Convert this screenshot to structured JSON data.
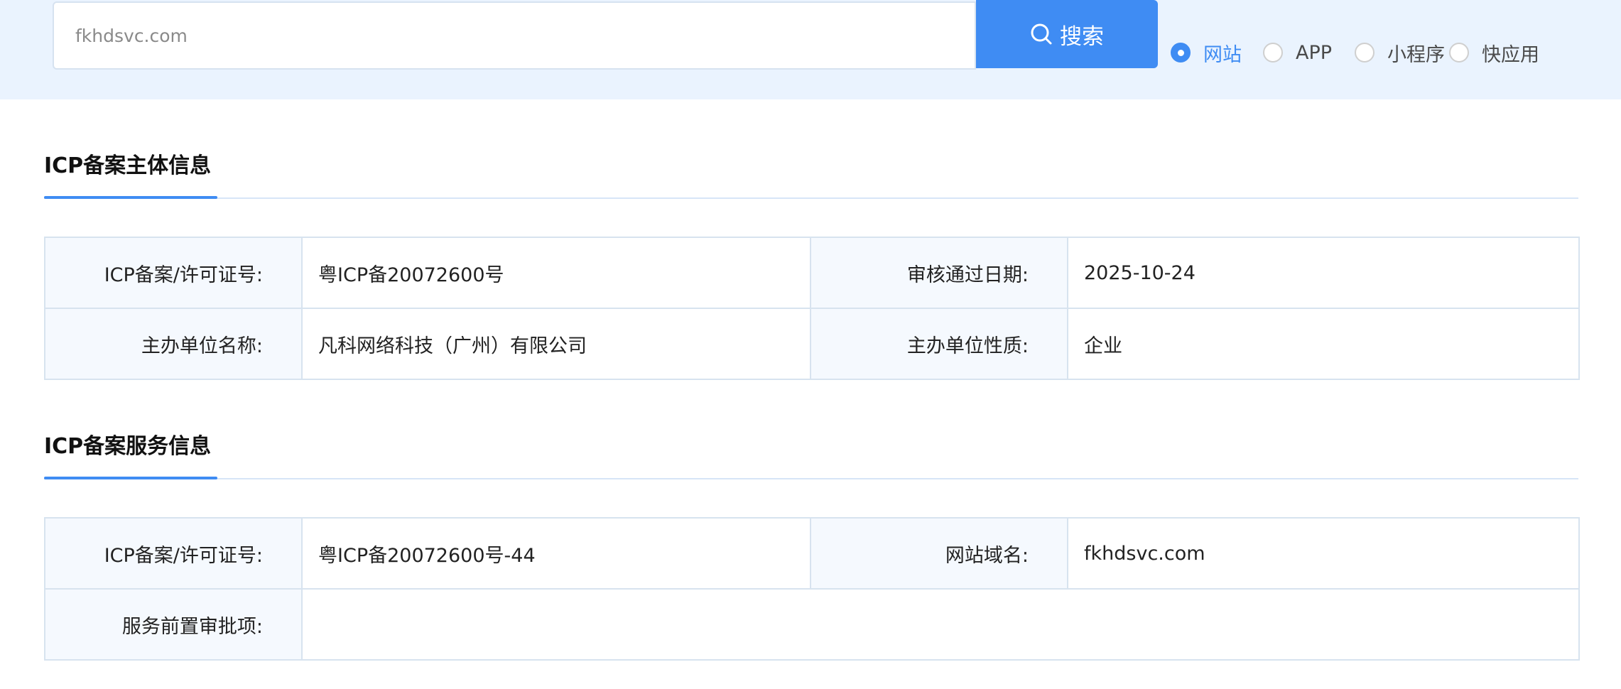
{
  "search": {
    "value": "fkhdsvc.com",
    "button_label": "搜索"
  },
  "radio_options": [
    {
      "label": "网站",
      "checked": true
    },
    {
      "label": "APP",
      "checked": false
    },
    {
      "label": "小程序",
      "checked": false
    },
    {
      "label": "快应用",
      "checked": false
    }
  ],
  "subject_section": {
    "title": "ICP备案主体信息",
    "rows": [
      {
        "k1": "ICP备案/许可证号:",
        "v1": "粤ICP备20072600号",
        "k2": "审核通过日期:",
        "v2": "2025-10-24"
      },
      {
        "k1": "主办单位名称:",
        "v1": "凡科网络科技（广州）有限公司",
        "k2": "主办单位性质:",
        "v2": "企业"
      }
    ]
  },
  "service_section": {
    "title": "ICP备案服务信息",
    "row1": {
      "k1": "ICP备案/许可证号:",
      "v1": "粤ICP备20072600号-44",
      "k2": "网站域名:",
      "v2": "fkhdsvc.com"
    },
    "row2": {
      "k1": "服务前置审批项:",
      "v1": ""
    }
  },
  "colors": {
    "accent": "#3f8cf3",
    "band": "#eaf3fe"
  }
}
